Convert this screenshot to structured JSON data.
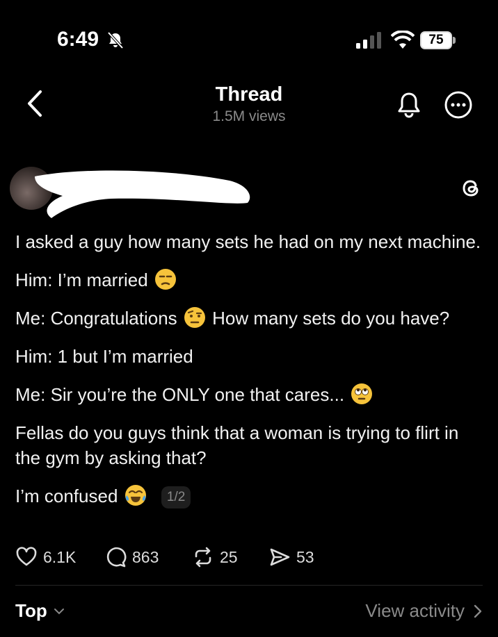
{
  "status_bar": {
    "time": "6:49",
    "battery": "75"
  },
  "header": {
    "title": "Thread",
    "views": "1.5M views"
  },
  "post": {
    "lines": [
      "I asked a guy how many sets he had on my next machine.",
      "Him: I’m married",
      "Me: Congratulations",
      "How many sets do you have?",
      "Him: 1 but I’m married",
      "Me: Sir you’re the ONLY one that cares...",
      "Fellas do you guys think that a woman is trying to flirt in the gym by asking that?",
      "I’m confused"
    ],
    "pager": "1/2"
  },
  "actions": {
    "likes": "6.1K",
    "replies": "863",
    "reposts": "25",
    "shares": "53"
  },
  "footer": {
    "sort_label": "Top",
    "activity_label": "View activity"
  },
  "icons": {
    "status": [
      "bell-slash-icon",
      "cellular-signal-icon",
      "wifi-icon",
      "battery-icon"
    ],
    "header": [
      "back-chevron-icon",
      "notification-bell-icon",
      "more-options-icon"
    ],
    "post": [
      "threads-logo-icon",
      "unamused-face-emoji",
      "raised-eyebrow-face-emoji",
      "rolling-eyes-face-emoji",
      "tears-of-joy-emoji"
    ],
    "actions": [
      "heart-icon",
      "comment-icon",
      "repost-icon",
      "send-icon"
    ]
  }
}
